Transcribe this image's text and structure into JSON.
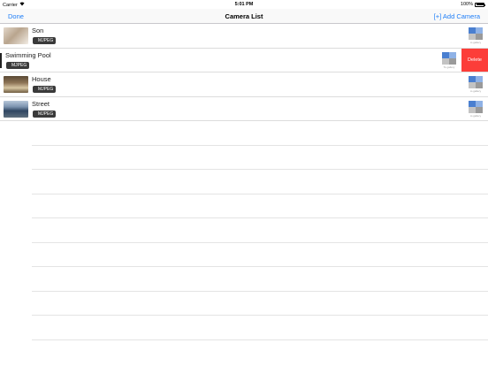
{
  "status_bar": {
    "carrier": "Carrier",
    "time": "5:01 PM",
    "battery": "100%"
  },
  "nav": {
    "done_label": "Done",
    "title": "Camera List",
    "add_label": "[+] Add Camera"
  },
  "cameras": [
    {
      "name": "Son",
      "type": "MJPEG",
      "gallery_label": "to gallery",
      "thumb_colors": [
        "#b9a58e",
        "#e6dcd0"
      ]
    },
    {
      "name": "Swimming Pool",
      "type": "MJPEG",
      "gallery_label": "To gallery",
      "thumb_colors": [
        "#ffffff",
        "#ffffff"
      ]
    },
    {
      "name": "House",
      "type": "MJPEG",
      "gallery_label": "to gallery",
      "thumb_colors": [
        "#6c5a43",
        "#d8c9a8"
      ]
    },
    {
      "name": "Street",
      "type": "MJPEG",
      "gallery_label": "to gallery",
      "thumb_colors": [
        "#3e5e86",
        "#9fb3c9"
      ]
    }
  ],
  "delete_label": "Delete",
  "colors": {
    "accent": "#1f7ef7",
    "delete": "#fc3d39",
    "badge": "#3a3a3a"
  }
}
